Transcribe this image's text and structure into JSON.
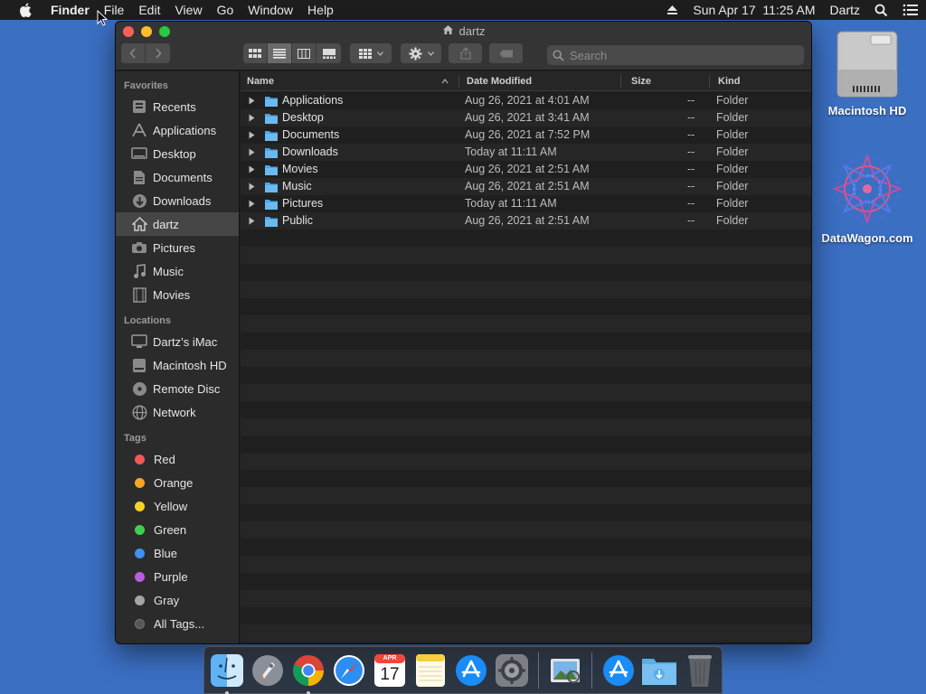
{
  "menubar": {
    "app": "Finder",
    "items": [
      "File",
      "Edit",
      "View",
      "Go",
      "Window",
      "Help"
    ],
    "datetime": "Sun Apr 17  11:25 AM",
    "user": "Dartz"
  },
  "desktop": {
    "icons": [
      {
        "label": "Macintosh HD",
        "icon": "hard-drive-icon"
      },
      {
        "label": "DataWagon.com",
        "icon": "mandala-icon"
      }
    ]
  },
  "window": {
    "title": "dartz",
    "search_placeholder": "Search",
    "columns": {
      "name": "Name",
      "date": "Date Modified",
      "size": "Size",
      "kind": "Kind"
    },
    "rows": [
      {
        "name": "Applications",
        "date": "Aug 26, 2021 at 4:01 AM",
        "size": "--",
        "kind": "Folder"
      },
      {
        "name": "Desktop",
        "date": "Aug 26, 2021 at 3:41 AM",
        "size": "--",
        "kind": "Folder"
      },
      {
        "name": "Documents",
        "date": "Aug 26, 2021 at 7:52 PM",
        "size": "--",
        "kind": "Folder"
      },
      {
        "name": "Downloads",
        "date": "Today at 11:11 AM",
        "size": "--",
        "kind": "Folder"
      },
      {
        "name": "Movies",
        "date": "Aug 26, 2021 at 2:51 AM",
        "size": "--",
        "kind": "Folder"
      },
      {
        "name": "Music",
        "date": "Aug 26, 2021 at 2:51 AM",
        "size": "--",
        "kind": "Folder"
      },
      {
        "name": "Pictures",
        "date": "Today at 11:11 AM",
        "size": "--",
        "kind": "Folder"
      },
      {
        "name": "Public",
        "date": "Aug 26, 2021 at 2:51 AM",
        "size": "--",
        "kind": "Folder"
      }
    ]
  },
  "sidebar": {
    "favorites_heading": "Favorites",
    "favorites": [
      {
        "label": "Recents",
        "icon": "clock-icon"
      },
      {
        "label": "Applications",
        "icon": "applications-icon"
      },
      {
        "label": "Desktop",
        "icon": "desktop-icon"
      },
      {
        "label": "Documents",
        "icon": "document-icon"
      },
      {
        "label": "Downloads",
        "icon": "download-icon"
      },
      {
        "label": "dartz",
        "icon": "home-icon",
        "selected": true
      },
      {
        "label": "Pictures",
        "icon": "camera-icon"
      },
      {
        "label": "Music",
        "icon": "music-icon"
      },
      {
        "label": "Movies",
        "icon": "film-icon"
      }
    ],
    "locations_heading": "Locations",
    "locations": [
      {
        "label": "Dartz’s iMac",
        "icon": "imac-icon"
      },
      {
        "label": "Macintosh HD",
        "icon": "disk-icon"
      },
      {
        "label": "Remote Disc",
        "icon": "disc-icon"
      },
      {
        "label": "Network",
        "icon": "globe-icon"
      }
    ],
    "tags_heading": "Tags",
    "tags": [
      {
        "label": "Red",
        "color": "#f0585a"
      },
      {
        "label": "Orange",
        "color": "#f5a623"
      },
      {
        "label": "Yellow",
        "color": "#f5d327"
      },
      {
        "label": "Green",
        "color": "#3fcf4f"
      },
      {
        "label": "Blue",
        "color": "#3f8ff5"
      },
      {
        "label": "Purple",
        "color": "#b65ee0"
      },
      {
        "label": "Gray",
        "color": "#a5a5a5"
      },
      {
        "label": "All Tags...",
        "color": "#555555"
      }
    ]
  },
  "dock": {
    "apps": [
      "finder",
      "launchpad",
      "chrome",
      "safari",
      "calendar",
      "notes",
      "app-store",
      "system-preferences",
      "preview",
      "app-store-2",
      "downloads-folder",
      "trash"
    ],
    "calendar_month": "APR",
    "calendar_day": "17"
  }
}
